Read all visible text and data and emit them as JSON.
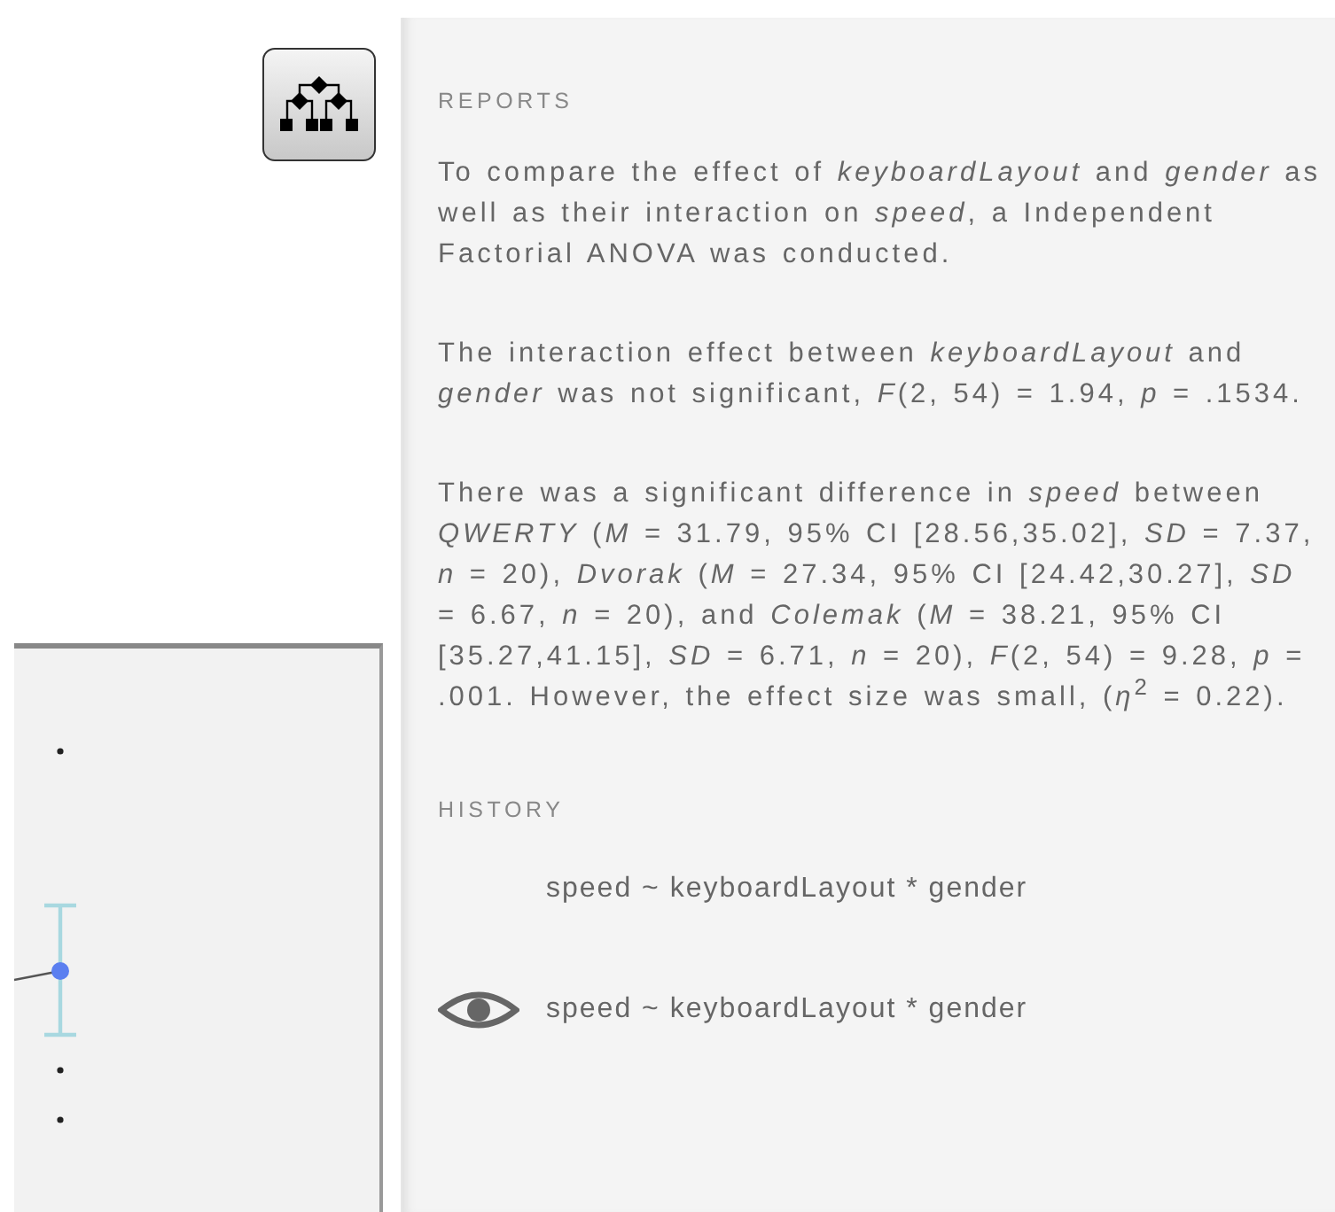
{
  "reports": {
    "heading": "REPORTS",
    "paragraphs": [
      "To compare the effect of *keyboardLayout* and *gender* as well as their interaction on *speed*, a Independent Factorial ANOVA was conducted.",
      "The interaction effect between *keyboardLayout* and *gender* was not significant, *F*(2, 54) = 1.94, *p* = .1534.",
      "There was a significant difference in *speed* between *QWERTY* (*M* = 31.79, 95% CI [28.56,35.02], *SD* = 7.37, *n* = 20), *Dvorak* (*M* = 27.34, 95% CI [24.42,30.27], *SD* = 6.67, *n* = 20), and *Colemak* (*M* = 38.21, 95% CI [35.27,41.15], *SD* = 6.71, *n* = 20), *F*(2, 54) = 9.28, *p* = .001. However, the effect size was small, (*η*$^{2}$ = 0.22)."
    ]
  },
  "history": {
    "heading": "HISTORY",
    "items": [
      {
        "formula": "speed ~ keyboardLayout * gender",
        "visible": false
      },
      {
        "formula": "speed ~ keyboardLayout * gender",
        "visible": true
      }
    ]
  }
}
